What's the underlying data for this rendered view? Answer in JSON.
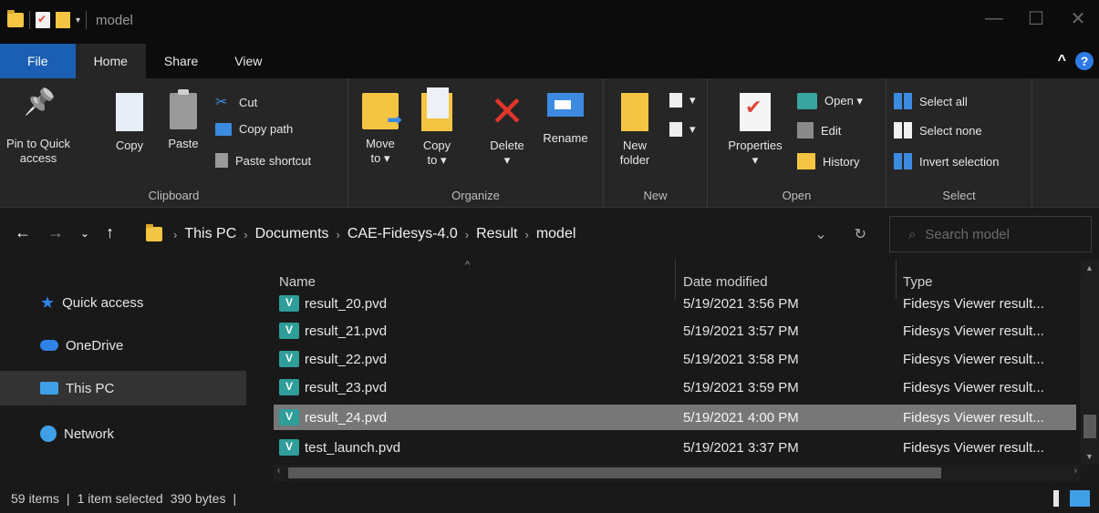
{
  "window": {
    "title": "model",
    "controls": {
      "minimize": "—",
      "maximize": "☐",
      "close": "✕"
    }
  },
  "tabs": [
    {
      "label": "File"
    },
    {
      "label": "Home"
    },
    {
      "label": "Share"
    },
    {
      "label": "View"
    }
  ],
  "ribbon": {
    "clipboard": {
      "label": "Clipboard",
      "pin_label_1": "Pin to Quick",
      "pin_label_2": "access",
      "copy": "Copy",
      "paste": "Paste",
      "cut": "Cut",
      "copy_path": "Copy path",
      "paste_shortcut": "Paste shortcut"
    },
    "organize": {
      "label": "Organize",
      "move_to_1": "Move",
      "move_to_2": "to ▾",
      "copy_to_1": "Copy",
      "copy_to_2": "to ▾",
      "delete_1": "Delete",
      "delete_2": "▾",
      "rename": "Rename"
    },
    "new": {
      "label": "New",
      "new_folder_1": "New",
      "new_folder_2": "folder"
    },
    "open": {
      "label": "Open",
      "properties_1": "Properties",
      "properties_2": "▾",
      "open": "Open ▾",
      "edit": "Edit",
      "history": "History"
    },
    "select": {
      "label": "Select",
      "select_all": "Select all",
      "select_none": "Select none",
      "invert_selection": "Invert selection"
    }
  },
  "address": {
    "breadcrumb": [
      "This PC",
      "Documents",
      "CAE-Fidesys-4.0",
      "Result",
      "model"
    ],
    "search_placeholder": "Search model"
  },
  "nav": [
    {
      "label": "Quick access",
      "icon": "star-icon"
    },
    {
      "label": "OneDrive",
      "icon": "cloud-icon"
    },
    {
      "label": "This PC",
      "icon": "pc-icon",
      "selected": true
    },
    {
      "label": "Network",
      "icon": "network-icon"
    }
  ],
  "columns": {
    "name": "Name",
    "date": "Date modified",
    "type": "Type"
  },
  "files": [
    {
      "name": "result_20.pvd",
      "date": "5/19/2021 3:56 PM",
      "type": "Fidesys Viewer result..."
    },
    {
      "name": "result_21.pvd",
      "date": "5/19/2021 3:57 PM",
      "type": "Fidesys Viewer result..."
    },
    {
      "name": "result_22.pvd",
      "date": "5/19/2021 3:58 PM",
      "type": "Fidesys Viewer result..."
    },
    {
      "name": "result_23.pvd",
      "date": "5/19/2021 3:59 PM",
      "type": "Fidesys Viewer result..."
    },
    {
      "name": "result_24.pvd",
      "date": "5/19/2021 4:00 PM",
      "type": "Fidesys Viewer result...",
      "selected": true
    },
    {
      "name": "test_launch.pvd",
      "date": "5/19/2021 3:37 PM",
      "type": "Fidesys Viewer result..."
    }
  ],
  "status": {
    "items": "59 items",
    "selected": "1 item selected",
    "size": "390 bytes"
  },
  "colors": {
    "file_tab": "#1a5fb4",
    "selection": "#777777",
    "accent": "#2f82e8"
  }
}
